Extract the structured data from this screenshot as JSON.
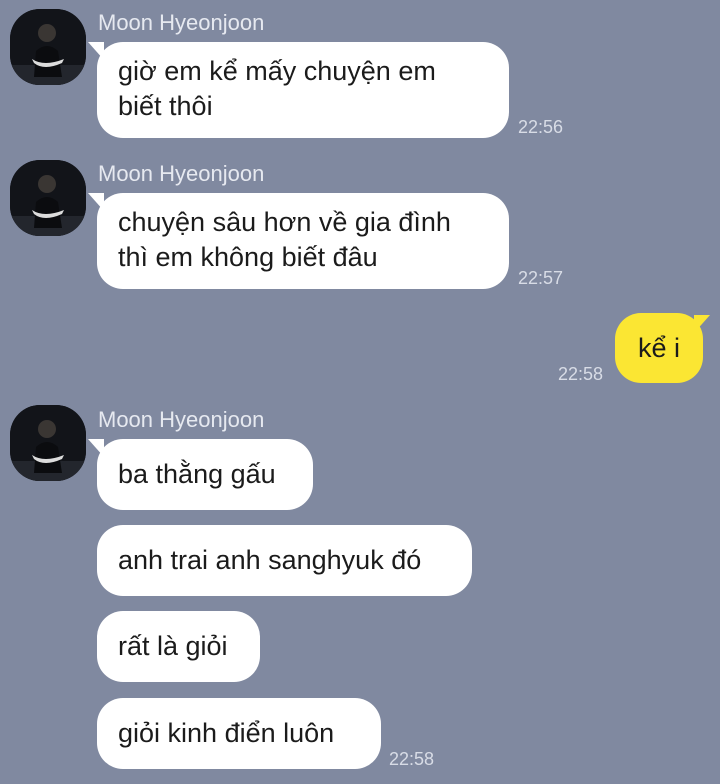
{
  "sender_name": "Moon Hyeonjoon",
  "messages": [
    {
      "from": "Moon Hyeonjoon",
      "lines": [
        "giờ em kể mấy chuyện em",
        "biết thôi"
      ],
      "time": "22:56"
    },
    {
      "from": "Moon Hyeonjoon",
      "lines": [
        "chuyện sâu hơn về gia đình",
        "thì em không biết đâu"
      ],
      "time": "22:57"
    },
    {
      "from": "me",
      "text": "kể i",
      "time": "22:58"
    },
    {
      "from": "Moon Hyeonjoon",
      "text": "ba thằng gấu"
    },
    {
      "from": "Moon Hyeonjoon",
      "text": "anh trai anh sanghyuk đó"
    },
    {
      "from": "Moon Hyeonjoon",
      "text": "rất là giỏi"
    },
    {
      "from": "Moon Hyeonjoon",
      "text": "giỏi kinh điển luôn",
      "time": "22:58"
    }
  ],
  "colors": {
    "chat_background": "#8089a0",
    "incoming_bubble": "#ffffff",
    "outgoing_bubble": "#fbe633"
  },
  "icons": {
    "avatar": "profile-photo-avatar"
  }
}
